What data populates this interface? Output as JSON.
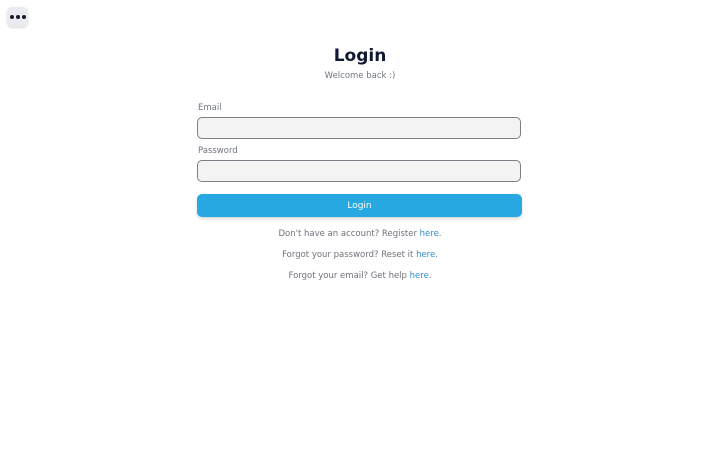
{
  "menu": {
    "icon": "more-horizontal-icon"
  },
  "header": {
    "title": "Login",
    "subtitle": "Welcome back :)"
  },
  "form": {
    "email_label": "Email",
    "email_value": "",
    "password_label": "Password",
    "password_value": "",
    "submit_label": "Login"
  },
  "links": {
    "register_text": "Don't have an account? Register ",
    "register_link": "here",
    "reset_text": "Forgot your password? Reset it ",
    "reset_link": "here",
    "email_help_text": "Forgot your email? Get help ",
    "email_help_link": "here",
    "period": "."
  },
  "colors": {
    "accent": "#27a8e0",
    "link": "#2b8fcf",
    "title": "#111a33"
  }
}
